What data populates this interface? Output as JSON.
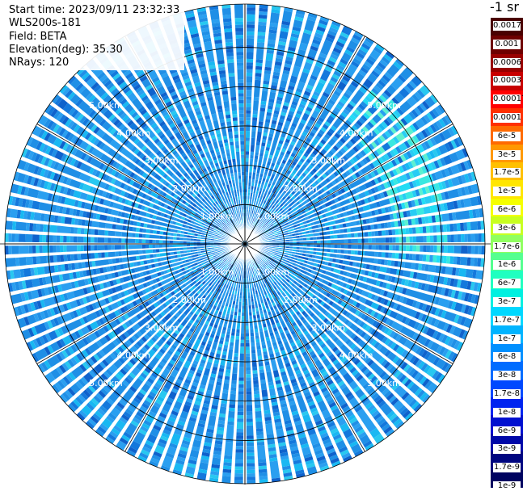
{
  "header": {
    "start_time": "Start time: 2023/09/11 23:32:33",
    "instrument": "WLS200s-181",
    "field": "Field: BETA",
    "elevation": "Elevation(deg): 35.30",
    "nrays": "NRays: 120"
  },
  "colorbar": {
    "units": "-1 sr",
    "labels": [
      "0.0017",
      "0.001",
      "0.0006",
      "0.0003",
      "0.00017",
      "0.0001",
      "6e-5",
      "3e-5",
      "1.7e-5",
      "1e-5",
      "6e-6",
      "3e-6",
      "1.7e-6",
      "1e-6",
      "6e-7",
      "3e-7",
      "1.7e-7",
      "1e-7",
      "6e-8",
      "3e-8",
      "1.7e-8",
      "1e-8",
      "6e-9",
      "3e-9",
      "1.7e-9",
      "1e-9"
    ],
    "colors": [
      "#4a0000",
      "#6e0000",
      "#990000",
      "#c80000",
      "#ff0000",
      "#ff3000",
      "#ff6a00",
      "#ff9800",
      "#ffc000",
      "#ffe600",
      "#f5ff00",
      "#c8ff20",
      "#90ff60",
      "#55ff90",
      "#20ffc0",
      "#00f0e0",
      "#00d8ff",
      "#00b4ff",
      "#0090ff",
      "#006cff",
      "#0048ff",
      "#0024f0",
      "#0010d0",
      "#0008a8",
      "#000680",
      "#000460"
    ]
  },
  "chart_data": {
    "type": "heatmap",
    "projection": "polar PPI",
    "field": "BETA",
    "n_rays": 120,
    "max_range_km": 6.1,
    "range_ring_labels": [
      "1.00km",
      "2.00km",
      "3.00km",
      "4.00km",
      "5.00km"
    ],
    "range_ring_values_km": [
      1,
      2,
      3,
      4,
      5
    ],
    "spoke_azimuths_deg": [
      0,
      30,
      60,
      90,
      120,
      150,
      180,
      210,
      240,
      270,
      300,
      330
    ],
    "ring_label_azimuths_deg": [
      45,
      135,
      225,
      315
    ],
    "typical_value_range": [
      1e-08,
      1e-07
    ],
    "enhanced_sector": {
      "azimuth_deg": [
        40,
        95
      ],
      "range_km": [
        3.8,
        5.2
      ],
      "approx_value": 2e-07
    },
    "colorbar_min": 1e-09,
    "colorbar_max": 0.0017,
    "color_scale": "log"
  }
}
